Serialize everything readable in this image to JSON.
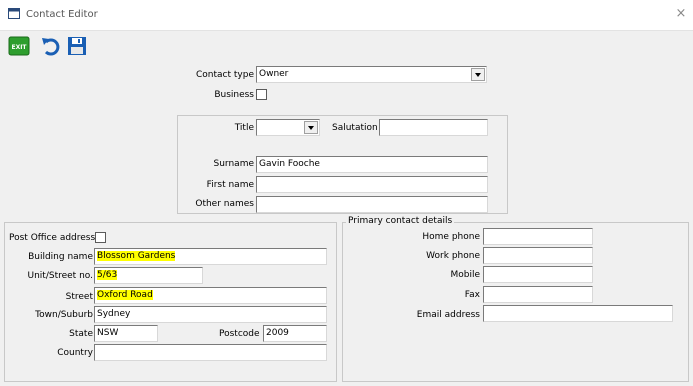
{
  "window": {
    "title": "Contact Editor",
    "close_glyph": "×"
  },
  "toolbar": {
    "exit_label": "EXIT",
    "undo_icon": "undo-arrow-icon",
    "save_icon": "floppy-disk-icon"
  },
  "contact": {
    "type_label": "Contact type",
    "type_value": "Owner",
    "business_label": "Business"
  },
  "name": {
    "title_label": "Title",
    "title_value": "",
    "salutation_label": "Salutation",
    "salutation_value": "",
    "surname_label": "Surname",
    "surname_value": "Gavin Fooche",
    "first_name_label": "First name",
    "first_name_value": "",
    "other_names_label": "Other names",
    "other_names_value": ""
  },
  "address": {
    "po_label": "Post Office address",
    "building_label": "Building name",
    "building_value": "Blossom Gardens",
    "unit_label": "Unit/Street no.",
    "unit_value": "5/63",
    "street_label": "Street",
    "street_value": "Oxford Road",
    "suburb_label": "Town/Suburb",
    "suburb_value": "Sydney",
    "state_label": "State",
    "state_value": "NSW",
    "postcode_label": "Postcode",
    "postcode_value": "2009",
    "country_label": "Country",
    "country_value": ""
  },
  "primary": {
    "legend": "Primary contact details",
    "home_label": "Home phone",
    "work_label": "Work phone",
    "mobile_label": "Mobile",
    "fax_label": "Fax",
    "email_label": "Email address"
  },
  "colors": {
    "highlight": "#ffff00",
    "exit_green": "#2e9e2e",
    "icon_blue": "#1a5fb4"
  }
}
